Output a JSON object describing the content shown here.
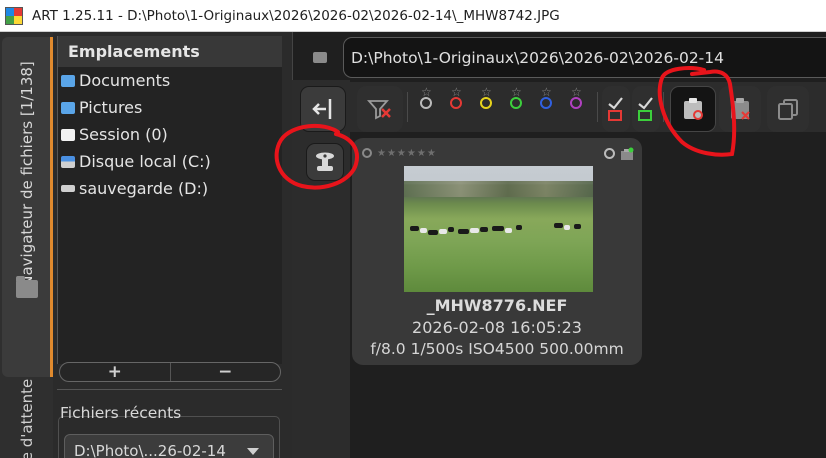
{
  "window": {
    "title": "ART 1.25.11 - D:\\Photo\\1-Originaux\\2026\\2026-02\\2026-02-14\\_MHW8742.JPG"
  },
  "side_tabs": {
    "file_browser": "Navigateur de fichiers   [1/138]",
    "queue": "e d'attente"
  },
  "places": {
    "header": "Emplacements",
    "items": [
      {
        "label": "Documents",
        "icon": "folder-icon"
      },
      {
        "label": "Pictures",
        "icon": "folder-icon"
      },
      {
        "label": "Session (0)",
        "icon": "session-icon"
      },
      {
        "label": "Disque local (C:)",
        "icon": "drive-icon"
      },
      {
        "label": "sauvegarde (D:)",
        "icon": "external-drive-icon"
      }
    ],
    "add_label": "+",
    "remove_label": "−"
  },
  "recent": {
    "label": "Fichiers récents",
    "selected": "D:\\Photo\\...26-02-14"
  },
  "path": {
    "value": "D:\\Photo\\1-Originaux\\2026\\2026-02\\2026-02-14"
  },
  "rank_filter": {
    "star_glyph": "☆",
    "colors": [
      "#bbbbbb",
      "#e53935",
      "#e6d21c",
      "#3ccf3c",
      "#3060e0",
      "#b040c0"
    ]
  },
  "thumbnail": {
    "stars": "★★★★★★",
    "filename": "_MHW8776.NEF",
    "datetime": "2026-02-08 16:05:23",
    "exif": "f/8.0 1/500s ISO4500 500.00mm"
  },
  "annotation_color": "#e8141b"
}
